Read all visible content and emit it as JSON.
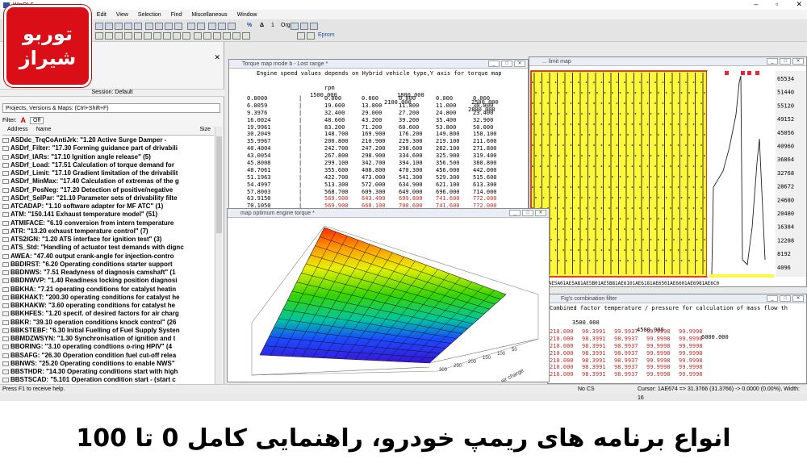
{
  "app": {
    "title": "WinOLS"
  },
  "brand": {
    "line1": "توربو",
    "line2": "شیراز",
    "color": "#d90e17"
  },
  "menu": [
    "Project",
    "Edit",
    "View",
    "Selection",
    "Find",
    "Miscellaneous",
    "Window"
  ],
  "toolbar": {
    "percent": "%",
    "delta": "Δ",
    "one": "1",
    "org": "Org",
    "eprom": "Eprom"
  },
  "left": {
    "session": "Session: Default",
    "projects_select": "Projects, Versions & Maps: (Ctrl+Shift+F)",
    "filter_label": "Filter:",
    "filter_off": "Off",
    "col_address": "Address",
    "col_name": "Name",
    "col_size": "Size",
    "maps": [
      "ASDdc_TrqCoAntiJrk: \"1.20     Active Surge Damper - ",
      "ASDrf_Filter: \"17.30     Forming guidance part of drivabili",
      "ASDrf_IARs: \"17.10     Ignition angle release\" (5)",
      "ASDrf_Load: \"17.51     Calculation of torque demand for",
      "ASDrf_Limit: \"17.10     Gradient limitation of the drivabilit",
      "ASDrf_MinMax: \"17.40     Calculation of extremas of the g",
      "ASDrf_PosNeg: \"17.20     Detection of positive/negative",
      "ASDrf_SelPar: \"21.10     Parameter sets of drivability filte",
      "ATCADAP: \"1.10     software adapter for MF ATC\" (1)",
      "ATM: \"150.141     Exhaust temperature model\" (51)",
      "ATMIFACE: \"6.10     conversion from intern temperature",
      "ATR: \"13.20     exhaust temperature control\" (7)",
      "ATS2IGN: \"1.20     ATS interface for ignition test\" (3)",
      "ATS_Std: \"Handling of actuator test demands with dignc",
      "AWEA: \"47.40     output crank-angle for injection-contro",
      "BBDIRST: \"6.20     Operating conditions starter support",
      "BBDNWS: \"7.51     Readyness of diagnosis camshaft\" (1",
      "BBDNWVP: \"1.40     Readiness locking position diagnosi",
      "BBKHA: \"7.21     operating conditions for catalyst heatin",
      "BBKHAKT: \"200.30     operating conditions for catalyst he",
      "BBKHAKW: \"3.60     operating conditions for catalyst he",
      "BBKHFES: \"1.20     specif. of desired factors for air charg",
      "BBKR: \"39.10     operation conditions knock control\" (26",
      "BBKSTEBF: \"6.30     Initial Fuelling of Fuel Supply Systen",
      "BBMDZWSYN: \"1.30     Synchronisation of ignition and t",
      "BBORING: \"3.10     operating condtions o-ring HPIV\" (4",
      "BBSAFG: \"26.30     Operation condition fuel cut-off relea",
      "BBNWS: \"25.20     Operating conditions to enable NWS\"",
      "BBSTHDR: \"14.30     Operating conditions start with high",
      "BBSTSCAD: \"5.101     Operation condition start - (start c"
    ]
  },
  "torque_window": {
    "title": "Torque map mode b - Lost range *",
    "header": "Engine speed values depends on Hybrid vehicle type,Y axis for torque map",
    "rpm_label": "rpm",
    "x_axis_top": [
      "1800.000",
      "2500.000"
    ],
    "x_axis_bottom": [
      "1500.000",
      "2100.000",
      "2800.000"
    ],
    "rows": [
      {
        "y": "0.0000",
        "v": [
          "0.000",
          "0.000",
          "0.000",
          "0.000",
          "0.000"
        ],
        "hl": false
      },
      {
        "y": "6.0059",
        "v": [
          "19.600",
          "13.800",
          "11.800",
          "11.000",
          "30.800"
        ],
        "hl": false
      },
      {
        "y": "9.3976",
        "v": [
          "32.400",
          "29.000",
          "27.200",
          "24.800",
          "23.400"
        ],
        "hl": false
      },
      {
        "y": "16.0024",
        "v": [
          "48.600",
          "43.200",
          "39.200",
          "35.400",
          "32.900"
        ],
        "hl": false
      },
      {
        "y": "19.9961",
        "v": [
          "83.200",
          "71.200",
          "60.600",
          "53.800",
          "50.000"
        ],
        "hl": false
      },
      {
        "y": "30.2049",
        "v": [
          "148.700",
          "169.900",
          "176.200",
          "149.800",
          "158.100"
        ],
        "hl": false
      },
      {
        "y": "35.9967",
        "v": [
          "200.800",
          "210.900",
          "229.300",
          "219.100",
          "211.600"
        ],
        "hl": false
      },
      {
        "y": "40.4004",
        "v": [
          "242.700",
          "247.200",
          "298.600",
          "282.100",
          "271.800"
        ],
        "hl": false
      },
      {
        "y": "43.0054",
        "v": [
          "267.800",
          "298.900",
          "334.600",
          "325.900",
          "319.400"
        ],
        "hl": false
      },
      {
        "y": "45.8008",
        "v": [
          "299.100",
          "342.700",
          "394.100",
          "356.500",
          "380.800"
        ],
        "hl": false
      },
      {
        "y": "48.7061",
        "v": [
          "355.600",
          "408.800",
          "470.300",
          "456.000",
          "442.000"
        ],
        "hl": false
      },
      {
        "y": "51.1963",
        "v": [
          "422.700",
          "473.000",
          "541.300",
          "529.300",
          "515.600"
        ],
        "hl": false
      },
      {
        "y": "54.4997",
        "v": [
          "513.300",
          "572.000",
          "634.900",
          "621.100",
          "613.300"
        ],
        "hl": false
      },
      {
        "y": "57.8003",
        "v": [
          "568.700",
          "609.300",
          "649.000",
          "696.000",
          "714.000"
        ],
        "hl": false
      },
      {
        "y": "63.9150",
        "v": [
          "569.900",
          "643.400",
          "699.800",
          "741.600",
          "772.000"
        ],
        "hl": true
      },
      {
        "y": "70.1050",
        "v": [
          "569.900",
          "660.100",
          "700.600",
          "741.600",
          "772.000"
        ],
        "hl": true
      },
      {
        "y": "79.5020",
        "v": [
          "569.900",
          "660.100",
          "700.600",
          "741.600",
          "772.000"
        ],
        "hl": true
      }
    ]
  },
  "yellow_window": {
    "title": "... limit map",
    "y_axis": [
      "65534",
      "51440",
      "55120",
      "49152",
      "45056",
      "40960",
      "36864",
      "32768",
      "28672",
      "24680",
      "20480",
      "16384",
      "12288",
      "8192",
      "4096"
    ],
    "x_axis": [
      "1AE5A0",
      "1AE5A8",
      "1AE5B0",
      "1AE5B8",
      "1AE610",
      "1AE618",
      "1AE650",
      "1AE660",
      "1AE698",
      "1AE6C0"
    ]
  },
  "combined_window": {
    "title": "Fig's combination filter",
    "header": "Combined factor temperature / pressure for calculation of mass flow th",
    "cols": [
      "3500.000",
      "4500.000",
      "6000.000"
    ],
    "rows": [
      [
        "210.000",
        "90.3991",
        "99.9937",
        "99.9998",
        "99.9998"
      ],
      [
        "210.000",
        "98.3991",
        "98.9937",
        "99.9998",
        "99.9998"
      ],
      [
        "210.000",
        "98.3991",
        "98.9937",
        "99.9998",
        "99.9998"
      ],
      [
        "210.000",
        "98.3991",
        "98.9937",
        "99.9998",
        "99.9998"
      ],
      [
        "210.000",
        "98.3991",
        "98.9937",
        "99.9998",
        "99.9998"
      ],
      [
        "210.000",
        "98.3991",
        "98.9937",
        "99.9998",
        "99.9998"
      ],
      [
        "210.000",
        "98.3991",
        "98.9937",
        "99.9998",
        "99.9998"
      ]
    ]
  },
  "surface_window": {
    "title": "map optimum engine torque *",
    "axis_labels": [
      "300",
      "250",
      "200",
      "150",
      "100",
      "50",
      "air charge"
    ]
  },
  "status": {
    "help": "Press F1 to receive help.",
    "mode": "No CS",
    "cursor": "Cursor: 1AE674 => 31.3766 (31.3766) -> 0.0000 (0.00%), Width: 16"
  },
  "banner": {
    "text": "انواع برنامه های ریمپ خودرو، راهنمایی کامل 0 تا 100"
  }
}
